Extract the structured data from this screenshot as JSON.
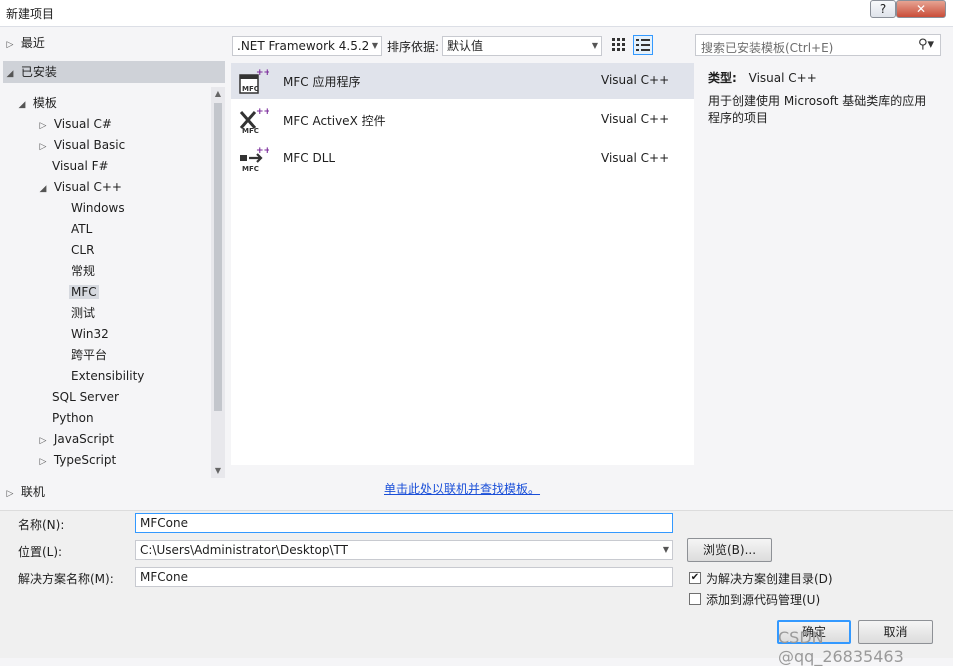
{
  "window": {
    "title": "新建项目",
    "help_label": "?",
    "close_label": "✕"
  },
  "left_panel": {
    "recent": "最近",
    "installed": "已安装",
    "templates": "模板",
    "tree": [
      {
        "label": "Visual C#",
        "expander": "▷"
      },
      {
        "label": "Visual Basic",
        "expander": "▷"
      },
      {
        "label": "Visual F#",
        "expander": ""
      },
      {
        "label": "Visual C++",
        "expander": "◢"
      }
    ],
    "vcpp_children": [
      "Windows",
      "ATL",
      "CLR",
      "常规",
      "MFC",
      "测试",
      "Win32",
      "跨平台",
      "Extensibility"
    ],
    "tree_more": [
      {
        "label": "SQL Server",
        "expander": ""
      },
      {
        "label": "Python",
        "expander": ""
      },
      {
        "label": "JavaScript",
        "expander": "▷"
      },
      {
        "label": "TypeScript",
        "expander": "▷"
      }
    ],
    "online": "联机",
    "selected_item": "MFC"
  },
  "toolbar": {
    "framework": ".NET Framework 4.5.2",
    "sort_label": "排序依据:",
    "sort_value": "默认值"
  },
  "search": {
    "placeholder": "搜索已安装模板(Ctrl+E)"
  },
  "templates": [
    {
      "name": "MFC 应用程序",
      "lang": "Visual C++",
      "icon": "mfc-app-icon"
    },
    {
      "name": "MFC ActiveX 控件",
      "lang": "Visual C++",
      "icon": "mfc-activex-icon"
    },
    {
      "name": "MFC DLL",
      "lang": "Visual C++",
      "icon": "mfc-dll-icon"
    }
  ],
  "online_link": "单击此处以联机并查找模板。",
  "details": {
    "type_label": "类型:",
    "type_value": "Visual C++",
    "description": "用于创建使用 Microsoft 基础类库的应用程序的项目"
  },
  "form": {
    "name_label": "名称(N):",
    "name_value": "MFCone",
    "location_label": "位置(L):",
    "location_value": "C:\\Users\\Administrator\\Desktop\\TT",
    "solution_label": "解决方案名称(M):",
    "solution_value": "MFCone",
    "browse_label": "浏览(B)...",
    "create_dir_label": "为解决方案创建目录(D)",
    "create_dir_checked": true,
    "source_control_label": "添加到源代码管理(U)",
    "source_control_checked": false,
    "ok_label": "确定",
    "cancel_label": "取消"
  },
  "watermark": "CSDN @qq_26835463",
  "colors": {
    "accent_selected": "#e0e3eb",
    "installed_header": "#cfd2d8",
    "link": "#1a4fd8"
  }
}
